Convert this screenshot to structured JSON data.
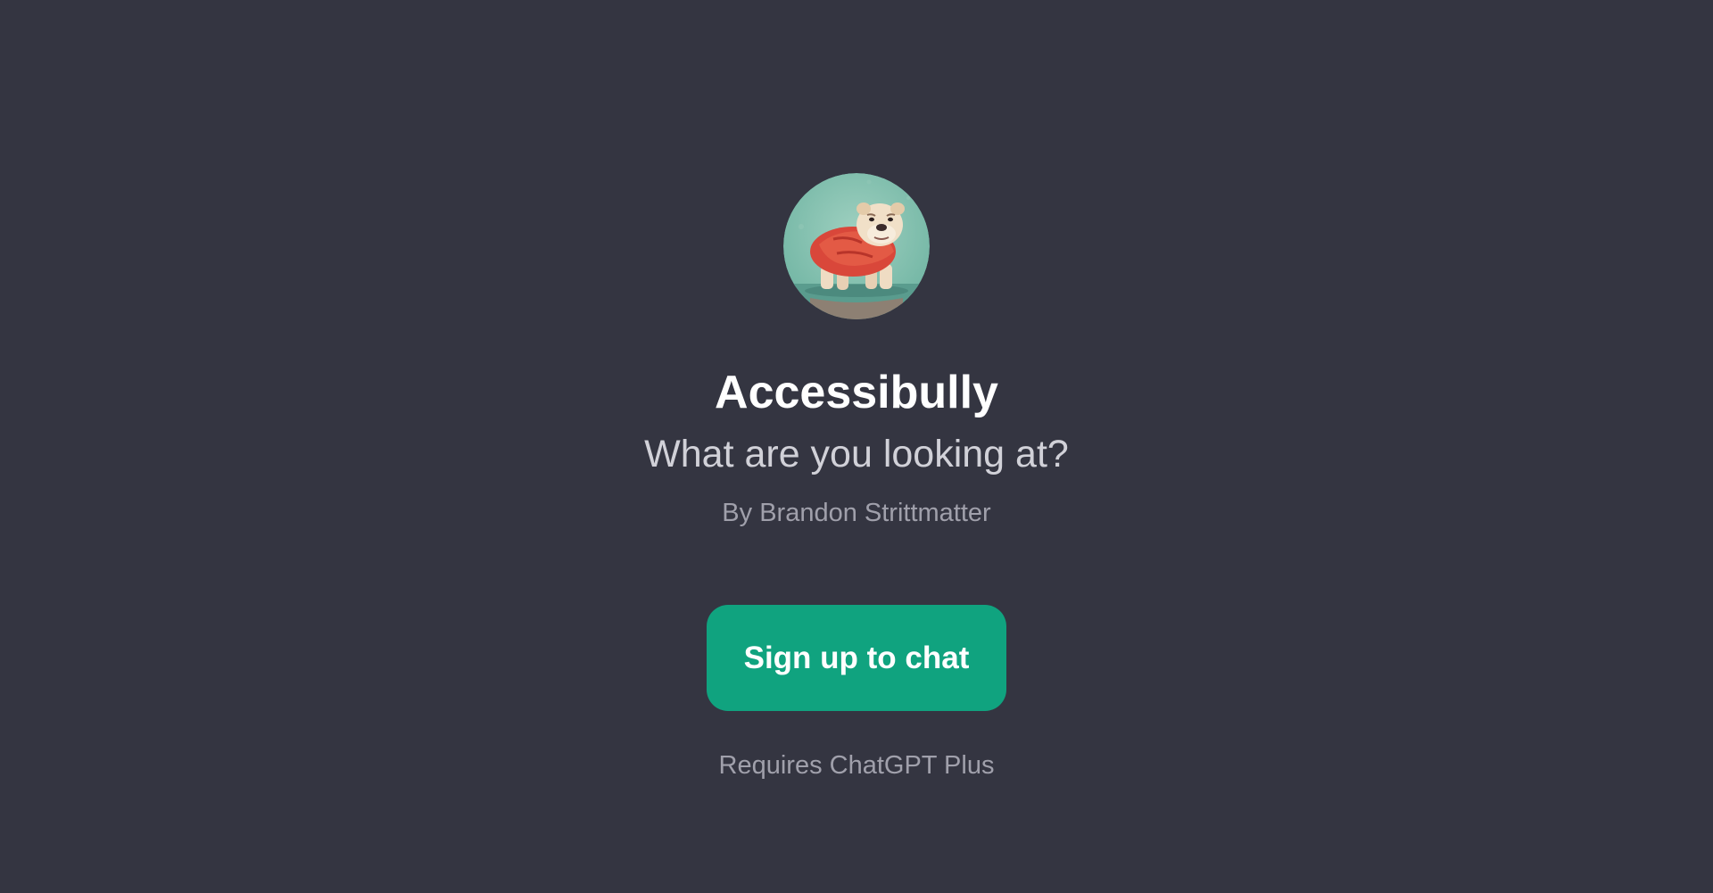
{
  "gpt": {
    "name": "Accessibully",
    "tagline": "What are you looking at?",
    "author": "By Brandon Strittmatter",
    "avatar_icon": "bulldog-avatar-icon"
  },
  "actions": {
    "signup_label": "Sign up to chat",
    "requirement_note": "Requires ChatGPT Plus"
  },
  "colors": {
    "background": "#343541",
    "accent": "#10a37f",
    "title_text": "#ffffff",
    "secondary_text": "#a0a0ab"
  }
}
